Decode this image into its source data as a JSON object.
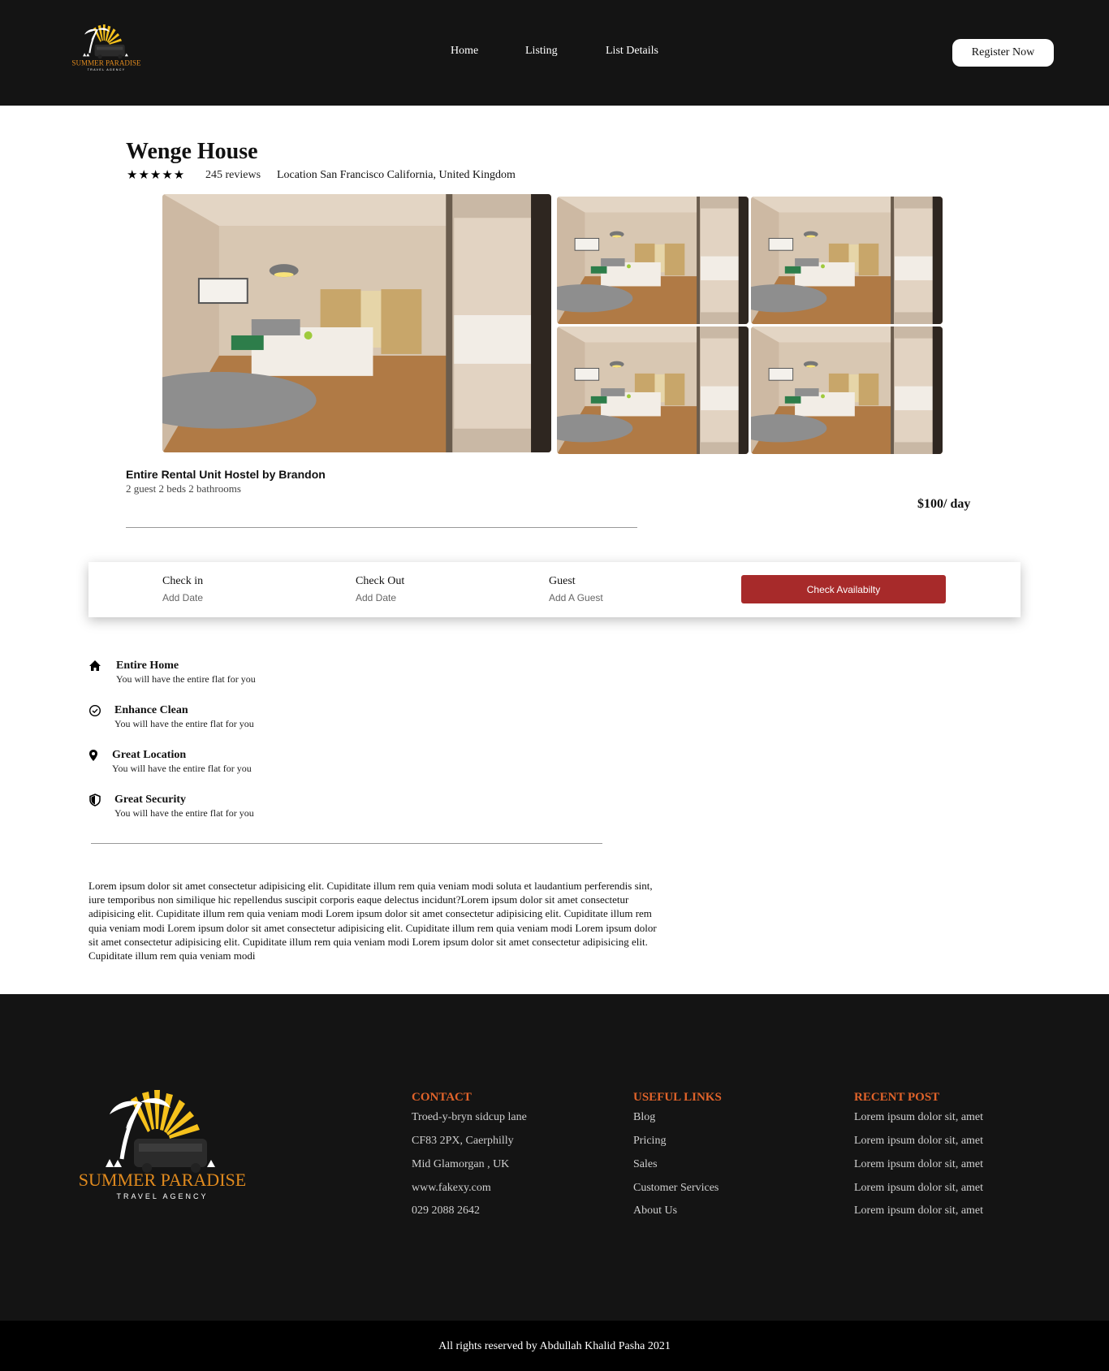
{
  "brand": {
    "name": "SUMMER PARADISE",
    "tagline": "TRAVEL AGENCY",
    "colors": {
      "sun": "#f5c11c",
      "text_orange": "#e08a1e"
    }
  },
  "nav": {
    "items": [
      "Home",
      "Listing",
      "List Details"
    ],
    "register_label": "Register Now"
  },
  "listing": {
    "title": "Wenge House",
    "rating_stars": "★★★★★",
    "rating": 5,
    "reviews": "245 reviews",
    "location": "Location San Francisco California, United Kingdom",
    "rental_title": "Entire Rental Unit Hostel by Brandon",
    "rental_sub": "2 guest 2 beds 2 bathrooms",
    "price": "$100/ day"
  },
  "booking": {
    "check_in_label": "Check in",
    "check_in_value": "Add Date",
    "check_out_label": "Check Out",
    "check_out_value": "Add Date",
    "guest_label": "Guest",
    "guest_value": "Add A Guest",
    "button_label": "Check Availabilty",
    "button_color": "#a72a2a"
  },
  "features": [
    {
      "icon": "home-icon",
      "title": "Entire Home",
      "sub": "You will have the entire flat for you"
    },
    {
      "icon": "check-circle-icon",
      "title": "Enhance Clean",
      "sub": "You will have the entire flat for you"
    },
    {
      "icon": "map-pin-icon",
      "title": "Great Location",
      "sub": "You will have the entire flat for you"
    },
    {
      "icon": "shield-icon",
      "title": "Great Security",
      "sub": "You will have the entire flat for you"
    }
  ],
  "description": "Lorem ipsum dolor sit amet consectetur adipisicing elit. Cupiditate illum rem quia veniam modi soluta et laudantium perferendis sint, iure temporibus non similique hic repellendus suscipit corporis eaque delectus incidunt?Lorem ipsum dolor sit amet consectetur adipisicing elit. Cupiditate illum rem quia veniam modi Lorem ipsum dolor sit amet consectetur adipisicing elit. Cupiditate illum rem quia veniam modi Lorem ipsum dolor sit amet consectetur adipisicing elit. Cupiditate illum rem quia veniam modi Lorem ipsum dolor sit amet consectetur adipisicing elit. Cupiditate illum rem quia veniam modi Lorem ipsum dolor sit amet consectetur adipisicing elit. Cupiditate illum rem quia veniam modi",
  "footer": {
    "contact": {
      "heading": "CONTACT",
      "items": [
        "Troed-y-bryn sidcup lane",
        "CF83 2PX, Caerphilly",
        "Mid Glamorgan , UK",
        "www.fakexy.com",
        "029 2088 2642"
      ]
    },
    "useful_links": {
      "heading": "USEFUL LINKS",
      "items": [
        "Blog",
        "Pricing",
        "Sales",
        "Customer Services",
        "About Us"
      ]
    },
    "recent_post": {
      "heading": "RECENT POST",
      "items": [
        "Lorem ipsum dolor sit, amet",
        "Lorem ipsum dolor sit, amet",
        "Lorem ipsum dolor sit, amet",
        "Lorem ipsum dolor sit, amet",
        "Lorem ipsum dolor sit, amet"
      ]
    },
    "heading_color": "#e0632a",
    "copyright": "All rights reserved by Abdullah Khalid Pasha 2021"
  }
}
